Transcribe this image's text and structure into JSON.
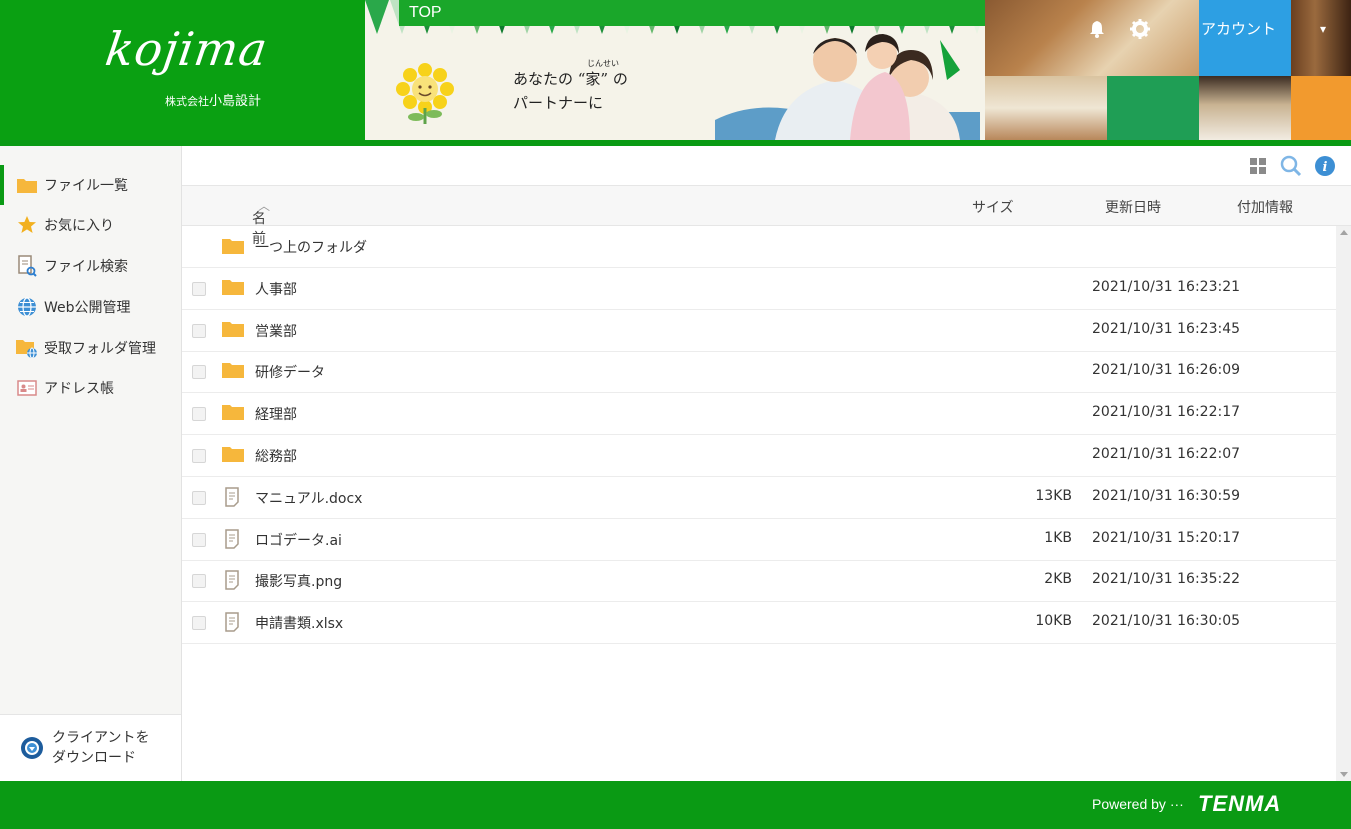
{
  "header": {
    "logo_text": "kojima",
    "logo_sub_small": "株式会社",
    "logo_sub_large": "小島設計",
    "top_tab": "TOP",
    "tagline_line1": "あなたの “家” の",
    "tagline_ruby": "じんせい",
    "tagline_line2": "パートナーに",
    "bell_icon": "bell-icon",
    "gear_icon": "gear-icon",
    "account_label": "アカウント",
    "colors": {
      "green": "#0a9a14",
      "account_blue": "#2d9fe3",
      "orange": "#f29a2e"
    }
  },
  "sidebar": {
    "items": [
      {
        "label": "ファイル一覧",
        "icon": "folder-icon",
        "active": true
      },
      {
        "label": "お気に入り",
        "icon": "star-icon",
        "active": false
      },
      {
        "label": "ファイル検索",
        "icon": "file-search-icon",
        "active": false
      },
      {
        "label": "Web公開管理",
        "icon": "globe-icon",
        "active": false
      },
      {
        "label": "受取フォルダ管理",
        "icon": "receive-folder-icon",
        "active": false
      },
      {
        "label": "アドレス帳",
        "icon": "address-book-icon",
        "active": false
      }
    ],
    "client_download_line1": "クライアントを",
    "client_download_line2": "ダウンロード"
  },
  "table": {
    "columns": {
      "name": "名前",
      "size": "サイズ",
      "updated": "更新日時",
      "extra": "付加情報"
    },
    "parent_folder": "一つ上のフォルダ",
    "rows": [
      {
        "name": "人事部",
        "type": "folder",
        "size": "",
        "date": "2021/10/31 16:23:21"
      },
      {
        "name": "営業部",
        "type": "folder",
        "size": "",
        "date": "2021/10/31 16:23:45"
      },
      {
        "name": "研修データ",
        "type": "folder",
        "size": "",
        "date": "2021/10/31 16:26:09"
      },
      {
        "name": "経理部",
        "type": "folder",
        "size": "",
        "date": "2021/10/31 16:22:17"
      },
      {
        "name": "総務部",
        "type": "folder",
        "size": "",
        "date": "2021/10/31 16:22:07"
      },
      {
        "name": "マニュアル.docx",
        "type": "file",
        "size": "13KB",
        "date": "2021/10/31 16:30:59"
      },
      {
        "name": "ロゴデータ.ai",
        "type": "file",
        "size": "1KB",
        "date": "2021/10/31 15:20:17"
      },
      {
        "name": "撮影写真.png",
        "type": "file",
        "size": "2KB",
        "date": "2021/10/31 16:35:22"
      },
      {
        "name": "申請書類.xlsx",
        "type": "file",
        "size": "10KB",
        "date": "2021/10/31 16:30:05"
      }
    ]
  },
  "footer": {
    "powered_by": "Powered by ···",
    "brand": "TENMA"
  }
}
